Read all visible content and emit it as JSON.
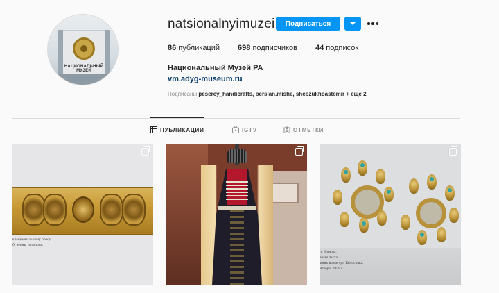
{
  "profile": {
    "username": "natsionalnyimuzei",
    "follow_label": "Подписаться",
    "stats": [
      {
        "num": "86",
        "label": "публикаций"
      },
      {
        "num": "698",
        "label": "подписчиков"
      },
      {
        "num": "44",
        "label": "подписок"
      }
    ],
    "full_name": "Национальный Музей РА",
    "website": "vm.adyg-museum.ru",
    "followed_by_prefix": "Подписаны",
    "followed_by_names": "peserey_handicrafts, berslan.mishe, shebzukhoastemir",
    "followed_by_more": "+ еще 2",
    "avatar_sign": "НАЦИОНАЛЬНЫЙ МУЗЕЙ"
  },
  "tabs": [
    {
      "label": "ПУБЛИКАЦИИ",
      "icon": "grid-icon",
      "active": true
    },
    {
      "label": "IGTV",
      "icon": "igtv-icon",
      "active": false
    },
    {
      "label": "ОТМЕТКИ",
      "icon": "tagged-icon",
      "active": false
    }
  ],
  "posts": [
    {
      "caption_lines": [
        "к национальному поясу.",
        "б, чернь, позолота."
      ]
    },
    {
      "caption_lines": []
    },
    {
      "caption_lines": [
        "т. Бирюза.",
        "нная паста.",
        "ьник возле хут. Колосовка.",
        "яглера, 1959 г."
      ]
    }
  ],
  "colors": {
    "accent": "#0095f6",
    "link": "#00376b",
    "text": "#262626",
    "muted": "#8e8e8e",
    "border": "#dbdbdb"
  }
}
